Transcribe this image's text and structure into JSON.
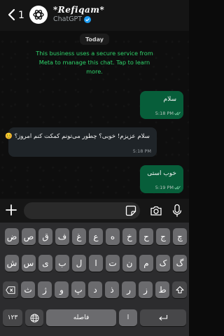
{
  "header": {
    "back_count": "1",
    "title": "*Refiqam*",
    "subtitle": "ChatGPT"
  },
  "chat": {
    "date": "Today",
    "system_message": "This business uses a secure service from Meta to manage this chat. Tap to learn more.",
    "messages": [
      {
        "direction": "outgoing",
        "text": "سلام",
        "time": "5:18 PM",
        "status": "read"
      },
      {
        "direction": "incoming",
        "text": "سلام عزیزم! خوبی؟ چطور می‌تونم کمکت کنم امروز؟ 😊",
        "time": "5:18 PM"
      },
      {
        "direction": "outgoing",
        "text": "خوب استی",
        "time": "5:19 PM",
        "status": "read"
      }
    ]
  },
  "input_bar": {
    "placeholder": ""
  },
  "keyboard": {
    "row1": [
      "چ",
      "ج",
      "ح",
      "خ",
      "ه",
      "ع",
      "غ",
      "ف",
      "ق",
      "ص",
      "ض"
    ],
    "row2": [
      "گ",
      "ک",
      "م",
      "ن",
      "ت",
      "ا",
      "ل",
      "ب",
      "ی",
      "س",
      "ش"
    ],
    "row3": [
      "ط",
      "ز",
      "ر",
      "ذ",
      "د",
      "پ",
      "و",
      "ژ",
      "ث"
    ],
    "numbers_key": "۱۲۳",
    "space_label": "فاصله",
    "zwnj_key": "‌ا‌",
    "colors": {
      "key": "#6b6b6e",
      "key_dark": "#474749",
      "background": "#2c2c2e",
      "outgoing_bubble": "#075e3a",
      "system_text": "#2fd46b"
    }
  }
}
